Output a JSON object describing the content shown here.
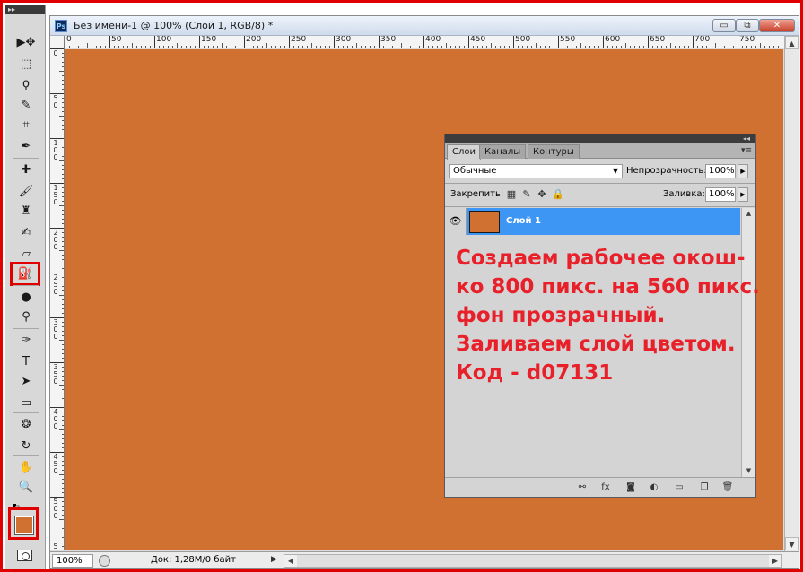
{
  "tools": {
    "header": "▸▸",
    "items": [
      {
        "name": "move-tool-icon",
        "glyph": "▶✥"
      },
      {
        "name": "marquee-tool-icon",
        "glyph": "⬚"
      },
      {
        "name": "lasso-tool-icon",
        "glyph": "ϙ"
      },
      {
        "name": "quick-select-tool-icon",
        "glyph": "✎"
      },
      {
        "name": "crop-tool-icon",
        "glyph": "⌗"
      },
      {
        "name": "eyedropper-tool-icon",
        "glyph": "✒"
      },
      {
        "name": "healing-brush-tool-icon",
        "glyph": "✚"
      },
      {
        "name": "brush-tool-icon",
        "glyph": "🖌"
      },
      {
        "name": "clone-stamp-tool-icon",
        "glyph": "♜"
      },
      {
        "name": "history-brush-tool-icon",
        "glyph": "✍"
      },
      {
        "name": "eraser-tool-icon",
        "glyph": "▱"
      },
      {
        "name": "paint-bucket-tool-icon",
        "glyph": "⛽"
      },
      {
        "name": "blur-tool-icon",
        "glyph": "●"
      },
      {
        "name": "dodge-tool-icon",
        "glyph": "⚲"
      },
      {
        "name": "pen-tool-icon",
        "glyph": "✑"
      },
      {
        "name": "type-tool-icon",
        "glyph": "T"
      },
      {
        "name": "path-select-tool-icon",
        "glyph": "➤"
      },
      {
        "name": "rectangle-tool-icon",
        "glyph": "▭"
      },
      {
        "name": "3d-rotate-tool-icon",
        "glyph": "❂"
      },
      {
        "name": "3d-orbit-tool-icon",
        "glyph": "↻"
      },
      {
        "name": "hand-tool-icon",
        "glyph": "✋"
      },
      {
        "name": "zoom-tool-icon",
        "glyph": "🔍"
      }
    ],
    "foreground_color": "#d07131"
  },
  "document": {
    "title": "Без имени-1 @ 100% (Слой 1, RGB/8) *",
    "app_icon": "Ps",
    "canvas_color": "#d07131",
    "ruler_top_labels": [
      "0",
      "50",
      "100",
      "150",
      "200",
      "250",
      "300",
      "350",
      "400",
      "450",
      "500",
      "550",
      "600",
      "650",
      "700",
      "750"
    ],
    "ruler_left_labels": [
      "0",
      "5 0",
      "1 0 0",
      "1 5 0",
      "2 0 0",
      "2 5 0",
      "3 0 0",
      "3 5 0",
      "4 0 0",
      "4 5 0",
      "5 0 0",
      "5"
    ],
    "zoom": "100%",
    "doc_info": "Док: 1,28M/0 байт",
    "window_buttons": {
      "minimize": "▭",
      "restore": "⧉",
      "close": "✕"
    }
  },
  "layers_panel": {
    "collapse": "◂◂",
    "tabs": [
      "Слои",
      "Каналы",
      "Контуры"
    ],
    "menu_icon": "▾≡",
    "blend_mode": "Обычные",
    "opacity_label": "Непрозрачность:",
    "opacity_value": "100%",
    "lock_label": "Закрепить:",
    "fill_label": "Заливка:",
    "fill_value": "100%",
    "layer_name": "Слой 1",
    "layer_color": "#d07131",
    "selection_color": "#3d95f4"
  },
  "instructions": {
    "lines": [
      "Создаем рабочее окош-",
      "ко 800 пикс. на 560 пикс.",
      "фон прозрачный.",
      "Заливаем слой цветом.",
      "Код - d07131"
    ],
    "color": "#e8202a"
  }
}
